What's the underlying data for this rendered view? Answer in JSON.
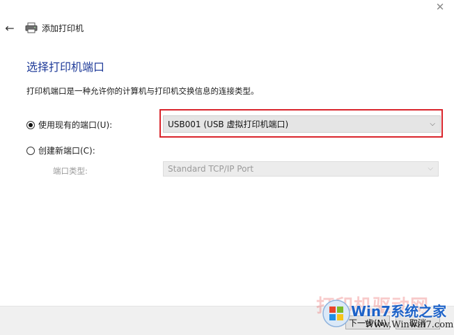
{
  "window": {
    "title": "添加打印机",
    "close_icon": "close-icon",
    "back_icon": "back-arrow-icon",
    "title_icon": "printer-icon"
  },
  "page": {
    "heading": "选择打印机端口",
    "description": "打印机端口是一种允许你的计算机与打印机交换信息的连接类型。"
  },
  "options": {
    "existing_port": {
      "label": "使用现有的端口(U):",
      "selected": true,
      "value": "USB001 (USB 虚拟打印机端口)"
    },
    "new_port": {
      "label": "创建新端口(C):",
      "selected": false,
      "type_label": "端口类型:",
      "type_value": "Standard TCP/IP Port"
    }
  },
  "footer": {
    "next_label": "下一步(N)",
    "cancel_label": "取消"
  },
  "watermark": {
    "text1": "打印机驱动网",
    "text2": "Win7系统之家",
    "text3": "Www.Winwin7.com"
  },
  "colors": {
    "heading": "#1f3b99",
    "highlight": "#d9232a",
    "footer_bg": "#f0f0f0"
  }
}
